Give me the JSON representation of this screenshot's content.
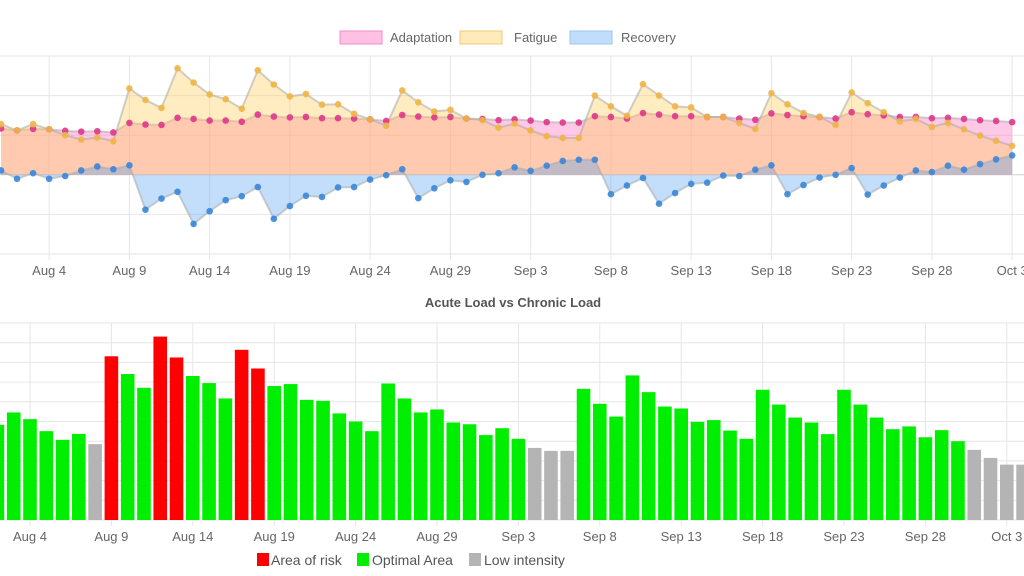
{
  "chart_data": [
    {
      "type": "area",
      "title": "",
      "ylim": [
        -2,
        3
      ],
      "grid": true,
      "legend_position": "top",
      "dates": [
        "Aug 1",
        "Aug 2",
        "Aug 3",
        "Aug 4",
        "Aug 5",
        "Aug 6",
        "Aug 7",
        "Aug 8",
        "Aug 9",
        "Aug 10",
        "Aug 11",
        "Aug 12",
        "Aug 13",
        "Aug 14",
        "Aug 15",
        "Aug 16",
        "Aug 17",
        "Aug 18",
        "Aug 19",
        "Aug 20",
        "Aug 21",
        "Aug 22",
        "Aug 23",
        "Aug 24",
        "Aug 25",
        "Aug 26",
        "Aug 27",
        "Aug 28",
        "Aug 29",
        "Aug 30",
        "Aug 31",
        "Sep 1",
        "Sep 2",
        "Sep 3",
        "Sep 4",
        "Sep 5",
        "Sep 6",
        "Sep 7",
        "Sep 8",
        "Sep 9",
        "Sep 10",
        "Sep 11",
        "Sep 12",
        "Sep 13",
        "Sep 14",
        "Sep 15",
        "Sep 16",
        "Sep 17",
        "Sep 18",
        "Sep 19",
        "Sep 20",
        "Sep 21",
        "Sep 22",
        "Sep 23",
        "Sep 24",
        "Sep 25",
        "Sep 26",
        "Sep 27",
        "Sep 28",
        "Sep 29",
        "Sep 30",
        "Oct 1",
        "Oct 2",
        "Oct 3"
      ],
      "x_ticks": [
        "Aug 4",
        "Aug 9",
        "Aug 14",
        "Aug 19",
        "Aug 24",
        "Aug 29",
        "Sep 3",
        "Sep 8",
        "Sep 13",
        "Sep 18",
        "Sep 23",
        "Sep 28",
        "Oct 3"
      ],
      "series": [
        {
          "name": "Adaptation",
          "fill": "rgba(255,110,190,0.38)",
          "point": "#e0358a",
          "values": [
            1.17,
            1.12,
            1.16,
            1.15,
            1.11,
            1.09,
            1.1,
            1.07,
            1.31,
            1.27,
            1.26,
            1.44,
            1.41,
            1.37,
            1.37,
            1.34,
            1.52,
            1.47,
            1.45,
            1.46,
            1.43,
            1.43,
            1.42,
            1.4,
            1.36,
            1.51,
            1.47,
            1.45,
            1.46,
            1.42,
            1.41,
            1.38,
            1.4,
            1.37,
            1.33,
            1.32,
            1.32,
            1.48,
            1.46,
            1.42,
            1.56,
            1.52,
            1.48,
            1.48,
            1.46,
            1.46,
            1.42,
            1.39,
            1.55,
            1.51,
            1.48,
            1.46,
            1.42,
            1.58,
            1.53,
            1.5,
            1.46,
            1.46,
            1.43,
            1.44,
            1.41,
            1.38,
            1.36,
            1.33
          ]
        },
        {
          "name": "Fatigue",
          "fill": "rgba(255,205,90,0.38)",
          "point": "#f0b545",
          "values": [
            1.28,
            1.12,
            1.28,
            1.15,
            1.0,
            0.89,
            0.94,
            0.85,
            2.18,
            1.89,
            1.69,
            2.69,
            2.33,
            2.03,
            1.91,
            1.67,
            2.64,
            2.28,
            1.98,
            2.04,
            1.77,
            1.78,
            1.54,
            1.4,
            1.24,
            2.13,
            1.83,
            1.6,
            1.64,
            1.42,
            1.38,
            1.19,
            1.29,
            1.12,
            0.98,
            0.93,
            0.93,
            2.0,
            1.73,
            1.49,
            2.29,
            2.0,
            1.73,
            1.7,
            1.46,
            1.46,
            1.31,
            1.16,
            2.06,
            1.78,
            1.56,
            1.46,
            1.26,
            2.08,
            1.81,
            1.58,
            1.35,
            1.41,
            1.21,
            1.31,
            1.15,
            0.99,
            0.86,
            0.73
          ]
        },
        {
          "name": "Recovery",
          "fill": "rgba(80,160,240,0.35)",
          "point": "#3a86d8",
          "values": [
            0.11,
            -0.1,
            0.04,
            -0.1,
            -0.03,
            0.11,
            0.21,
            0.14,
            0.24,
            -0.88,
            -0.6,
            -0.43,
            -1.24,
            -0.92,
            -0.64,
            -0.54,
            -0.31,
            -1.11,
            -0.79,
            -0.53,
            -0.56,
            -0.32,
            -0.31,
            -0.12,
            -0.01,
            0.14,
            -0.59,
            -0.34,
            -0.14,
            -0.18,
            0.0,
            0.04,
            0.19,
            0.1,
            0.23,
            0.35,
            0.38,
            0.38,
            -0.49,
            -0.27,
            -0.08,
            -0.73,
            -0.46,
            -0.23,
            -0.2,
            -0.02,
            -0.03,
            0.13,
            0.24,
            -0.49,
            -0.26,
            -0.07,
            0.0,
            0.17,
            -0.5,
            -0.27,
            -0.07,
            0.11,
            0.07,
            0.23,
            0.13,
            0.27,
            0.39,
            0.49
          ]
        }
      ]
    },
    {
      "type": "bar",
      "title": "Acute Load vs Chronic Load",
      "ylim": [
        0,
        10
      ],
      "grid": true,
      "legend_position": "bottom",
      "dates": [
        "Aug 2",
        "Aug 3",
        "Aug 4",
        "Aug 5",
        "Aug 6",
        "Aug 7",
        "Aug 8",
        "Aug 9",
        "Aug 10",
        "Aug 11",
        "Aug 12",
        "Aug 13",
        "Aug 14",
        "Aug 15",
        "Aug 16",
        "Aug 17",
        "Aug 18",
        "Aug 19",
        "Aug 20",
        "Aug 21",
        "Aug 22",
        "Aug 23",
        "Aug 24",
        "Aug 25",
        "Aug 26",
        "Aug 27",
        "Aug 28",
        "Aug 29",
        "Aug 30",
        "Aug 31",
        "Sep 1",
        "Sep 2",
        "Sep 3",
        "Sep 4",
        "Sep 5",
        "Sep 6",
        "Sep 7",
        "Sep 8",
        "Sep 9",
        "Sep 10",
        "Sep 11",
        "Sep 12",
        "Sep 13",
        "Sep 14",
        "Sep 15",
        "Sep 16",
        "Sep 17",
        "Sep 18",
        "Sep 19",
        "Sep 20",
        "Sep 21",
        "Sep 22",
        "Sep 23",
        "Sep 24",
        "Sep 25",
        "Sep 26",
        "Sep 27",
        "Sep 28",
        "Sep 29",
        "Sep 30",
        "Oct 1",
        "Oct 2",
        "Oct 3",
        "Oct 4"
      ],
      "x_ticks": [
        "Aug 4",
        "Aug 9",
        "Aug 14",
        "Aug 19",
        "Aug 24",
        "Aug 29",
        "Sep 3",
        "Sep 8",
        "Sep 13",
        "Sep 18",
        "Sep 23",
        "Sep 28",
        "Oct 3"
      ],
      "values": [
        4.83,
        5.46,
        5.12,
        4.51,
        4.07,
        4.37,
        3.85,
        8.31,
        7.41,
        6.71,
        9.31,
        8.25,
        7.31,
        6.95,
        6.17,
        8.64,
        7.69,
        6.8,
        6.9,
        6.1,
        6.05,
        5.41,
        5.0,
        4.51,
        6.93,
        6.17,
        5.46,
        5.61,
        4.95,
        4.86,
        4.31,
        4.66,
        4.12,
        3.66,
        3.51,
        3.51,
        6.66,
        5.9,
        5.25,
        7.34,
        6.49,
        5.76,
        5.66,
        4.98,
        5.07,
        4.54,
        4.12,
        6.61,
        5.86,
        5.2,
        4.95,
        4.36,
        6.61,
        5.86,
        5.2,
        4.61,
        4.75,
        4.2,
        4.56,
        4.0,
        3.56,
        3.15,
        2.81,
        2.81
      ],
      "zones": [
        "optimal",
        "optimal",
        "optimal",
        "optimal",
        "optimal",
        "optimal",
        "low",
        "risk",
        "optimal",
        "optimal",
        "risk",
        "risk",
        "optimal",
        "optimal",
        "optimal",
        "risk",
        "risk",
        "optimal",
        "optimal",
        "optimal",
        "optimal",
        "optimal",
        "optimal",
        "optimal",
        "optimal",
        "optimal",
        "optimal",
        "optimal",
        "optimal",
        "optimal",
        "optimal",
        "optimal",
        "optimal",
        "low",
        "low",
        "low",
        "optimal",
        "optimal",
        "optimal",
        "optimal",
        "optimal",
        "optimal",
        "optimal",
        "optimal",
        "optimal",
        "optimal",
        "optimal",
        "optimal",
        "optimal",
        "optimal",
        "optimal",
        "optimal",
        "optimal",
        "optimal",
        "optimal",
        "optimal",
        "optimal",
        "optimal",
        "optimal",
        "optimal",
        "low",
        "low",
        "low",
        "low"
      ],
      "legend": [
        {
          "key": "risk",
          "label": "Area of risk",
          "color": "#ff0000"
        },
        {
          "key": "optimal",
          "label": "Optimal Area",
          "color": "#00ee00"
        },
        {
          "key": "low",
          "label": "Low intensity",
          "color": "#b4b4b4"
        }
      ]
    }
  ]
}
